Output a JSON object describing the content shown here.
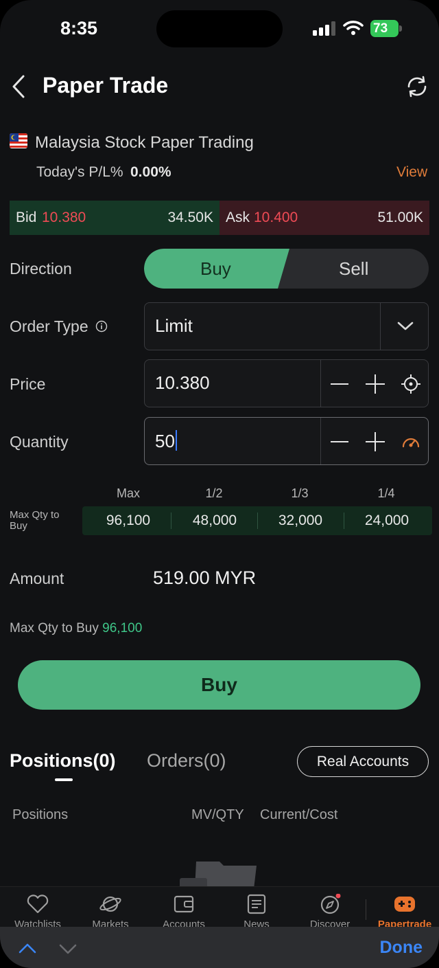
{
  "status_bar": {
    "time": "8:35",
    "battery": "73"
  },
  "header": {
    "title": "Paper Trade"
  },
  "account": {
    "name": "Malaysia Stock Paper Trading",
    "pl_label": "Today's P/L%",
    "pl_value": "0.00%",
    "view_link": "View"
  },
  "quote": {
    "bid_label": "Bid",
    "bid_price": "10.380",
    "bid_size": "34.50K",
    "ask_label": "Ask",
    "ask_price": "10.400",
    "ask_size": "51.00K"
  },
  "form": {
    "direction_label": "Direction",
    "buy_option": "Buy",
    "sell_option": "Sell",
    "selected_direction": "Buy",
    "order_type_label": "Order Type",
    "order_type_value": "Limit",
    "price_label": "Price",
    "price_value": "10.380",
    "quantity_label": "Quantity",
    "quantity_value": "50",
    "max_qty_label": "Max Qty to Buy",
    "qty_columns": [
      "Max",
      "1/2",
      "1/3",
      "1/4"
    ],
    "qty_values": [
      "96,100",
      "48,000",
      "32,000",
      "24,000"
    ],
    "amount_label": "Amount",
    "amount_value": "519.00 MYR",
    "max_qty_line_label": "Max Qty to Buy",
    "max_qty_line_value": "96,100",
    "submit_label": "Buy"
  },
  "positions": {
    "tabs": [
      "Positions(0)",
      "Orders(0)"
    ],
    "real_accounts_label": "Real Accounts",
    "columns": [
      "Positions",
      "MV/QTY",
      "Current/Cost"
    ]
  },
  "bottom_nav": [
    "Watchlists",
    "Markets",
    "Accounts",
    "News",
    "Discover",
    "Papertrade"
  ],
  "keyboard_bar": {
    "done_label": "Done"
  },
  "colors": {
    "accent_green": "#4eb27f",
    "bid_red": "#ef4b55",
    "link_orange": "#e07c3a",
    "done_blue": "#3b86f6"
  }
}
